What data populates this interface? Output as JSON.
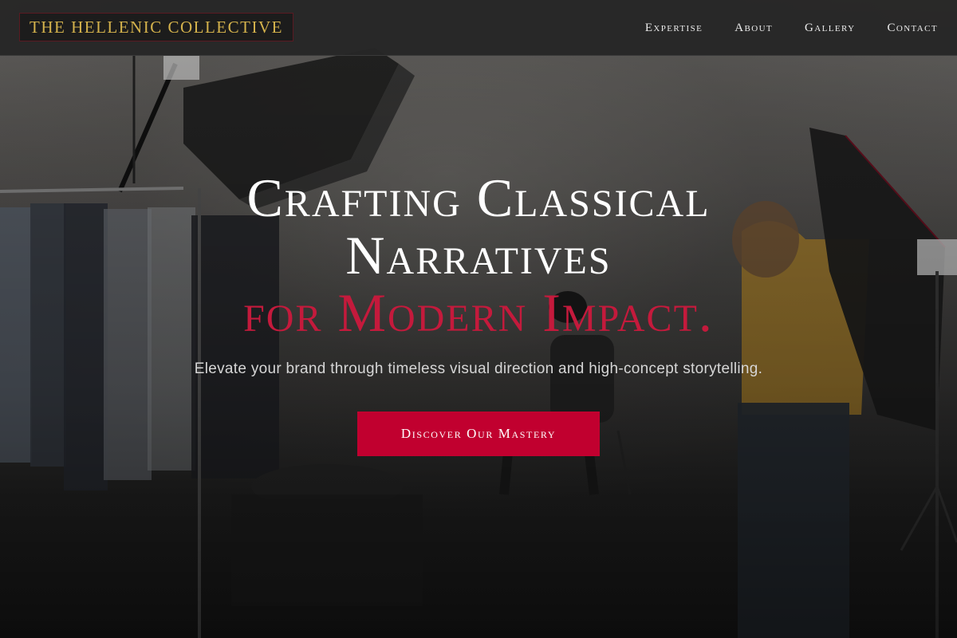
{
  "brand": {
    "name": "THE HELLENIC COLLECTIVE",
    "colors": {
      "gold": "#d4b24c",
      "crimson": "#c1002f",
      "navbar": "#262626"
    }
  },
  "nav": {
    "items": [
      {
        "label": "Expertise"
      },
      {
        "label": "About"
      },
      {
        "label": "Gallery"
      },
      {
        "label": "Contact"
      }
    ]
  },
  "hero": {
    "title_line1": "Crafting Classical",
    "title_line2": "Narratives",
    "title_accent": "for Modern Impact.",
    "subtitle": "Elevate your brand through timeless visual direction and high-concept storytelling.",
    "cta_label": "Discover Our Mastery",
    "background": "photo-studio-shoot"
  }
}
